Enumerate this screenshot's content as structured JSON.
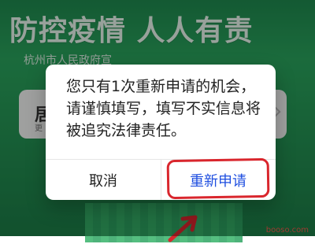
{
  "background": {
    "title": "防控疫情 人人有责",
    "subtitle": "杭州市人民政府宣",
    "card_big": "居",
    "card_small": "更"
  },
  "dialog": {
    "message": "您只有1次重新申请的机会，请谨慎填写，填写不实信息将被追究法律责任。",
    "cancel_label": "取消",
    "reapply_label": "重新申请"
  },
  "colors": {
    "primary_button": "#1f4fe0",
    "annotation_red": "#d9262d",
    "banner_green": "#2aa55d"
  },
  "watermark": "booso.com"
}
